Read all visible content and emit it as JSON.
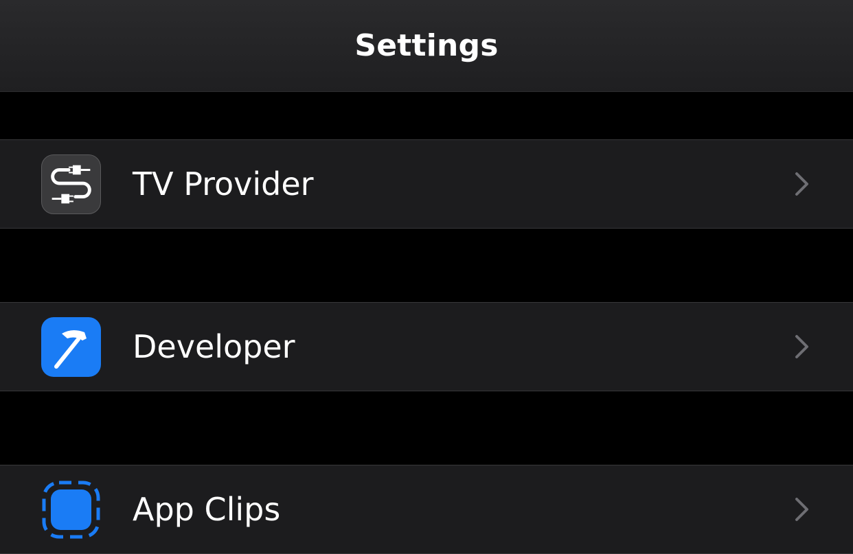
{
  "header": {
    "title": "Settings"
  },
  "rows": [
    {
      "label": "TV Provider",
      "icon": "tv-provider-icon"
    },
    {
      "label": "Developer",
      "icon": "hammer-icon"
    },
    {
      "label": "App Clips",
      "icon": "app-clips-icon"
    }
  ],
  "colors": {
    "row_background": "#1c1c1e",
    "page_background": "#000000",
    "separator": "#38383a",
    "developer_icon": "#1a7cf5",
    "app_clips_icon": "#1a7cf5",
    "chevron": "#6e6e73"
  }
}
